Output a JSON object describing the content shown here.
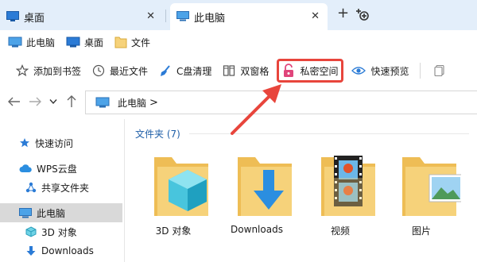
{
  "tabs": [
    {
      "label": "桌面",
      "icon": "monitor-icon",
      "active": false
    },
    {
      "label": "此电脑",
      "icon": "computer-icon",
      "active": true
    }
  ],
  "tab_close_glyph": "✕",
  "new_tab_glyph": "+",
  "favorites": [
    {
      "label": "此电脑",
      "icon": "computer-icon"
    },
    {
      "label": "桌面",
      "icon": "monitor-icon"
    },
    {
      "label": "文件",
      "icon": "folder-icon"
    }
  ],
  "toolbar": [
    {
      "label": "添加到书签",
      "icon": "star-icon"
    },
    {
      "label": "最近文件",
      "icon": "clock-icon"
    },
    {
      "label": "C盘清理",
      "icon": "broom-icon"
    },
    {
      "label": "双窗格",
      "icon": "dual-pane-icon"
    },
    {
      "label": "私密空间",
      "icon": "lock-icon",
      "highlighted": true
    },
    {
      "label": "快速预览",
      "icon": "eye-icon"
    }
  ],
  "address": {
    "path": "此电脑",
    "separator": ">"
  },
  "sidebar": {
    "items": [
      {
        "label": "快速访问",
        "icon": "pin-star-icon"
      },
      {
        "label": "WPS云盘",
        "icon": "cloud-icon"
      },
      {
        "label": "共享文件夹",
        "icon": "share-icon"
      },
      {
        "label": "此电脑",
        "icon": "computer-icon",
        "selected": true
      },
      {
        "label": "3D 对象",
        "icon": "cube-icon"
      },
      {
        "label": "Downloads",
        "icon": "download-icon"
      }
    ]
  },
  "content": {
    "group_label": "文件夹 (7)",
    "files": [
      {
        "name": "3D 对象",
        "icon": "folder-3d-icon"
      },
      {
        "name": "Downloads",
        "icon": "folder-download-icon"
      },
      {
        "name": "视频",
        "icon": "folder-video-icon"
      },
      {
        "name": "图片",
        "icon": "folder-picture-icon"
      }
    ]
  },
  "colors": {
    "accent": "#1f5fa8",
    "highlight_border": "#e8453c",
    "lock_pink": "#e0457b",
    "tabstrip_bg": "#e3eefa",
    "folder_yellow": "#f6d27a"
  }
}
